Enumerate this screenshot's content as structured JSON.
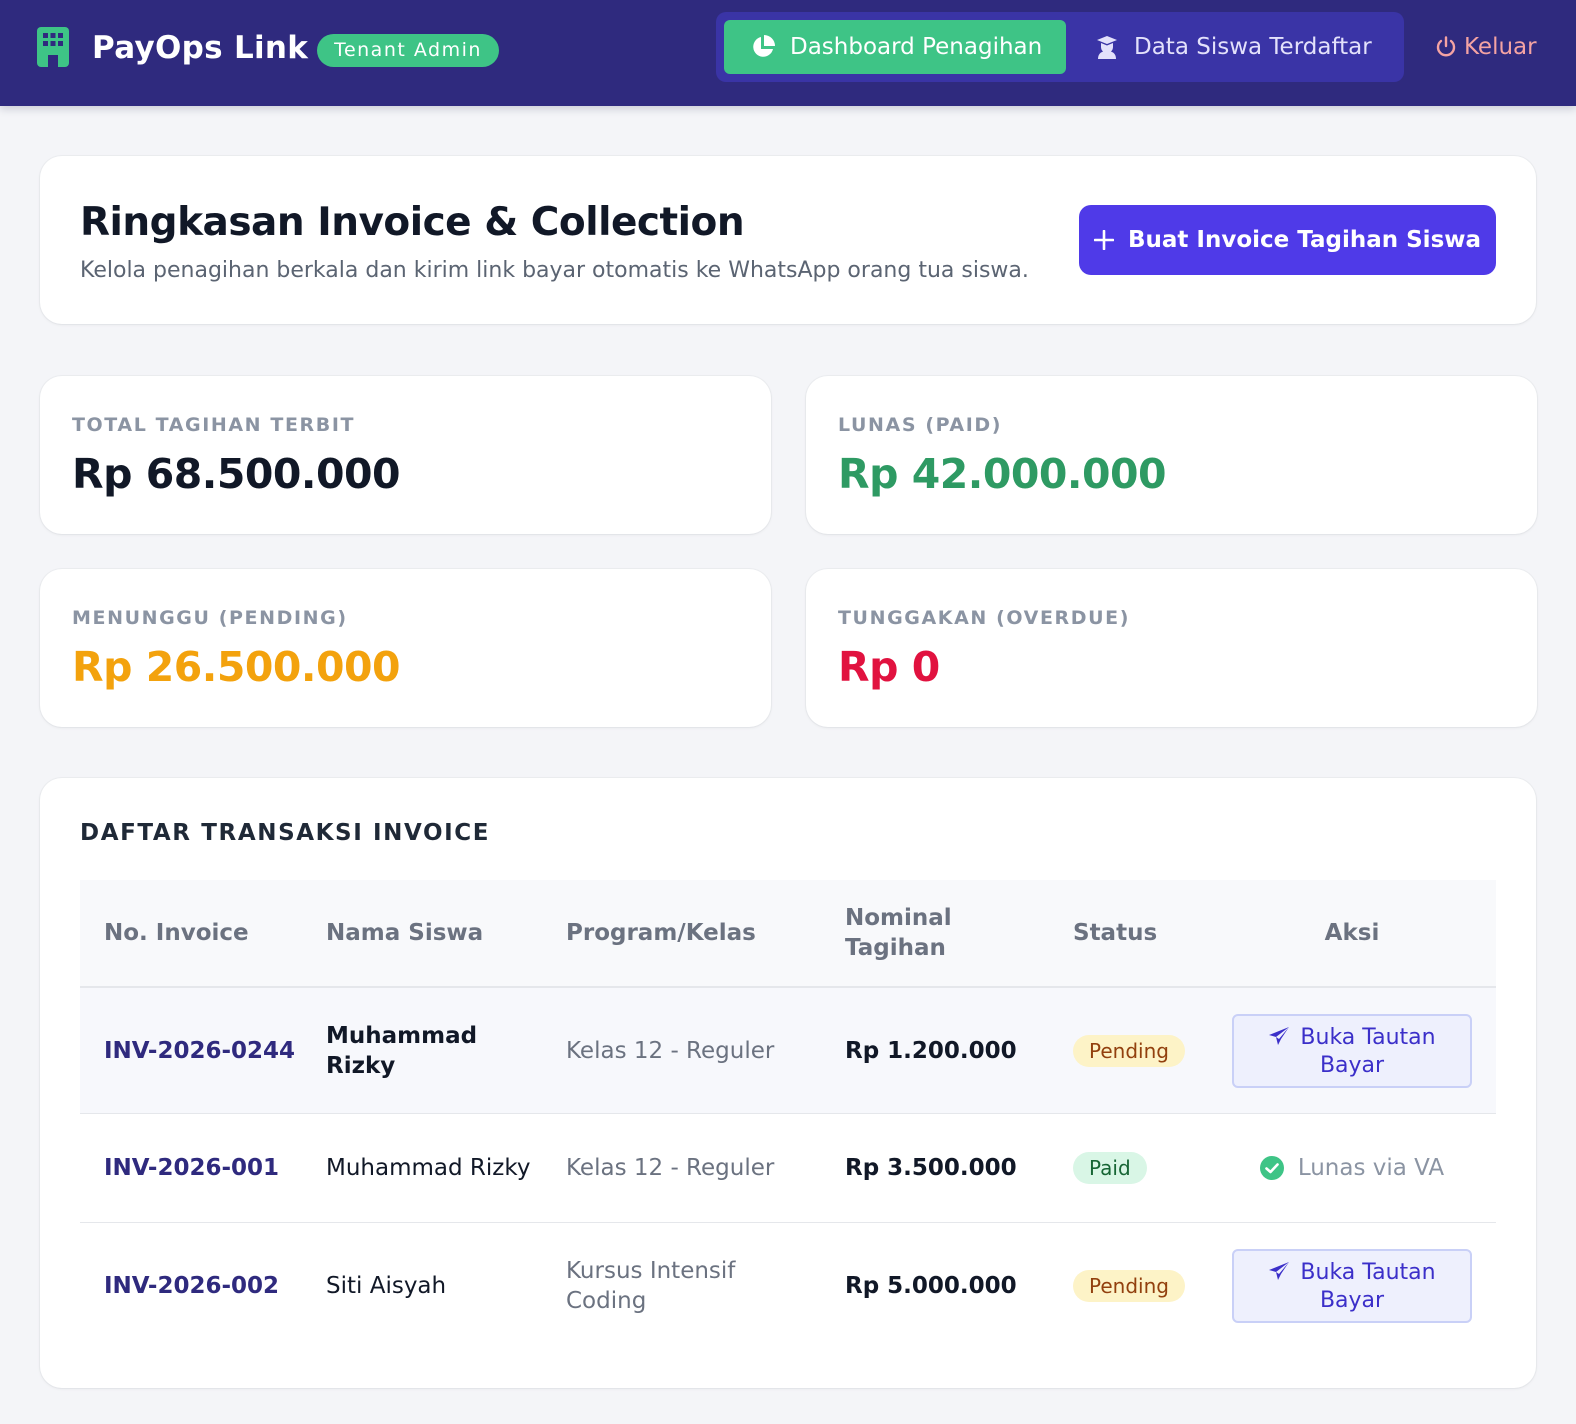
{
  "header": {
    "brand": "PayOps Link",
    "role_badge": "Tenant Admin",
    "nav": {
      "dashboard": "Dashboard Penagihan",
      "students": "Data Siswa Terdaftar"
    },
    "logout": "Keluar"
  },
  "summary": {
    "title": "Ringkasan Invoice & Collection",
    "subtitle": "Kelola penagihan berkala dan kirim link bayar otomatis ke WhatsApp orang tua siswa.",
    "create_button": "Buat Invoice Tagihan Siswa"
  },
  "stats": {
    "total": {
      "label": "TOTAL TAGIHAN TERBIT",
      "value": "Rp 68.500.000",
      "color": "#111827"
    },
    "paid": {
      "label": "LUNAS (PAID)",
      "value": "Rp 42.000.000",
      "color": "#2e9a63"
    },
    "pending": {
      "label": "MENUNGGU (PENDING)",
      "value": "Rp 26.500.000",
      "color": "#f3a20d"
    },
    "overdue": {
      "label": "TUNGGAKAN (OVERDUE)",
      "value": "Rp 0",
      "color": "#e1123f"
    }
  },
  "table": {
    "title": "DAFTAR TRANSAKSI INVOICE",
    "columns": {
      "invoice": "No. Invoice",
      "name": "Nama Siswa",
      "program": "Program/Kelas",
      "amount": "Nominal Tagihan",
      "status": "Status",
      "action": "Aksi"
    },
    "rows": [
      {
        "invoice": "INV-2026-0244",
        "name": "Muhammad Rizky",
        "program": "Kelas 12 - Reguler",
        "amount": "Rp 1.200.000",
        "status": "Pending",
        "action": "Buka Tautan Bayar"
      },
      {
        "invoice": "INV-2026-001",
        "name": "Muhammad Rizky",
        "program": "Kelas 12 - Reguler",
        "amount": "Rp 3.500.000",
        "status": "Paid",
        "action": "Lunas via VA"
      },
      {
        "invoice": "INV-2026-002",
        "name": "Siti Aisyah",
        "program": "Kursus Intensif Coding",
        "amount": "Rp 5.000.000",
        "status": "Pending",
        "action": "Buka Tautan Bayar"
      }
    ]
  },
  "colors": {
    "header_bg": "#2f2a7e",
    "accent_green": "#3ec486",
    "primary": "#4f3ae8"
  }
}
